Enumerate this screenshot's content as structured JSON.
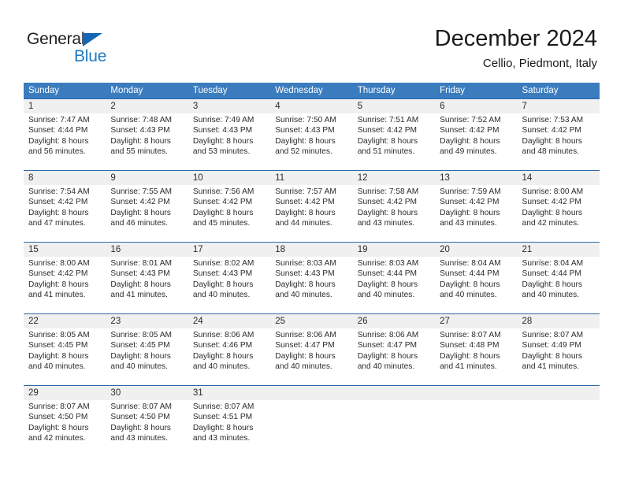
{
  "brand": {
    "word1": "General",
    "word2": "Blue",
    "accent_color": "#1e7bc4",
    "triangle_color": "#1567b3"
  },
  "header": {
    "title": "December 2024",
    "subtitle": "Cellio, Piedmont, Italy"
  },
  "calendar": {
    "header_bg": "#3a7cbe",
    "daynum_band_bg": "#f0f0f0",
    "weekdays": [
      "Sunday",
      "Monday",
      "Tuesday",
      "Wednesday",
      "Thursday",
      "Friday",
      "Saturday"
    ],
    "weeks": [
      [
        {
          "day": "1",
          "sunrise": "Sunrise: 7:47 AM",
          "sunset": "Sunset: 4:44 PM",
          "daylight1": "Daylight: 8 hours",
          "daylight2": "and 56 minutes."
        },
        {
          "day": "2",
          "sunrise": "Sunrise: 7:48 AM",
          "sunset": "Sunset: 4:43 PM",
          "daylight1": "Daylight: 8 hours",
          "daylight2": "and 55 minutes."
        },
        {
          "day": "3",
          "sunrise": "Sunrise: 7:49 AM",
          "sunset": "Sunset: 4:43 PM",
          "daylight1": "Daylight: 8 hours",
          "daylight2": "and 53 minutes."
        },
        {
          "day": "4",
          "sunrise": "Sunrise: 7:50 AM",
          "sunset": "Sunset: 4:43 PM",
          "daylight1": "Daylight: 8 hours",
          "daylight2": "and 52 minutes."
        },
        {
          "day": "5",
          "sunrise": "Sunrise: 7:51 AM",
          "sunset": "Sunset: 4:42 PM",
          "daylight1": "Daylight: 8 hours",
          "daylight2": "and 51 minutes."
        },
        {
          "day": "6",
          "sunrise": "Sunrise: 7:52 AM",
          "sunset": "Sunset: 4:42 PM",
          "daylight1": "Daylight: 8 hours",
          "daylight2": "and 49 minutes."
        },
        {
          "day": "7",
          "sunrise": "Sunrise: 7:53 AM",
          "sunset": "Sunset: 4:42 PM",
          "daylight1": "Daylight: 8 hours",
          "daylight2": "and 48 minutes."
        }
      ],
      [
        {
          "day": "8",
          "sunrise": "Sunrise: 7:54 AM",
          "sunset": "Sunset: 4:42 PM",
          "daylight1": "Daylight: 8 hours",
          "daylight2": "and 47 minutes."
        },
        {
          "day": "9",
          "sunrise": "Sunrise: 7:55 AM",
          "sunset": "Sunset: 4:42 PM",
          "daylight1": "Daylight: 8 hours",
          "daylight2": "and 46 minutes."
        },
        {
          "day": "10",
          "sunrise": "Sunrise: 7:56 AM",
          "sunset": "Sunset: 4:42 PM",
          "daylight1": "Daylight: 8 hours",
          "daylight2": "and 45 minutes."
        },
        {
          "day": "11",
          "sunrise": "Sunrise: 7:57 AM",
          "sunset": "Sunset: 4:42 PM",
          "daylight1": "Daylight: 8 hours",
          "daylight2": "and 44 minutes."
        },
        {
          "day": "12",
          "sunrise": "Sunrise: 7:58 AM",
          "sunset": "Sunset: 4:42 PM",
          "daylight1": "Daylight: 8 hours",
          "daylight2": "and 43 minutes."
        },
        {
          "day": "13",
          "sunrise": "Sunrise: 7:59 AM",
          "sunset": "Sunset: 4:42 PM",
          "daylight1": "Daylight: 8 hours",
          "daylight2": "and 43 minutes."
        },
        {
          "day": "14",
          "sunrise": "Sunrise: 8:00 AM",
          "sunset": "Sunset: 4:42 PM",
          "daylight1": "Daylight: 8 hours",
          "daylight2": "and 42 minutes."
        }
      ],
      [
        {
          "day": "15",
          "sunrise": "Sunrise: 8:00 AM",
          "sunset": "Sunset: 4:42 PM",
          "daylight1": "Daylight: 8 hours",
          "daylight2": "and 41 minutes."
        },
        {
          "day": "16",
          "sunrise": "Sunrise: 8:01 AM",
          "sunset": "Sunset: 4:43 PM",
          "daylight1": "Daylight: 8 hours",
          "daylight2": "and 41 minutes."
        },
        {
          "day": "17",
          "sunrise": "Sunrise: 8:02 AM",
          "sunset": "Sunset: 4:43 PM",
          "daylight1": "Daylight: 8 hours",
          "daylight2": "and 40 minutes."
        },
        {
          "day": "18",
          "sunrise": "Sunrise: 8:03 AM",
          "sunset": "Sunset: 4:43 PM",
          "daylight1": "Daylight: 8 hours",
          "daylight2": "and 40 minutes."
        },
        {
          "day": "19",
          "sunrise": "Sunrise: 8:03 AM",
          "sunset": "Sunset: 4:44 PM",
          "daylight1": "Daylight: 8 hours",
          "daylight2": "and 40 minutes."
        },
        {
          "day": "20",
          "sunrise": "Sunrise: 8:04 AM",
          "sunset": "Sunset: 4:44 PM",
          "daylight1": "Daylight: 8 hours",
          "daylight2": "and 40 minutes."
        },
        {
          "day": "21",
          "sunrise": "Sunrise: 8:04 AM",
          "sunset": "Sunset: 4:44 PM",
          "daylight1": "Daylight: 8 hours",
          "daylight2": "and 40 minutes."
        }
      ],
      [
        {
          "day": "22",
          "sunrise": "Sunrise: 8:05 AM",
          "sunset": "Sunset: 4:45 PM",
          "daylight1": "Daylight: 8 hours",
          "daylight2": "and 40 minutes."
        },
        {
          "day": "23",
          "sunrise": "Sunrise: 8:05 AM",
          "sunset": "Sunset: 4:45 PM",
          "daylight1": "Daylight: 8 hours",
          "daylight2": "and 40 minutes."
        },
        {
          "day": "24",
          "sunrise": "Sunrise: 8:06 AM",
          "sunset": "Sunset: 4:46 PM",
          "daylight1": "Daylight: 8 hours",
          "daylight2": "and 40 minutes."
        },
        {
          "day": "25",
          "sunrise": "Sunrise: 8:06 AM",
          "sunset": "Sunset: 4:47 PM",
          "daylight1": "Daylight: 8 hours",
          "daylight2": "and 40 minutes."
        },
        {
          "day": "26",
          "sunrise": "Sunrise: 8:06 AM",
          "sunset": "Sunset: 4:47 PM",
          "daylight1": "Daylight: 8 hours",
          "daylight2": "and 40 minutes."
        },
        {
          "day": "27",
          "sunrise": "Sunrise: 8:07 AM",
          "sunset": "Sunset: 4:48 PM",
          "daylight1": "Daylight: 8 hours",
          "daylight2": "and 41 minutes."
        },
        {
          "day": "28",
          "sunrise": "Sunrise: 8:07 AM",
          "sunset": "Sunset: 4:49 PM",
          "daylight1": "Daylight: 8 hours",
          "daylight2": "and 41 minutes."
        }
      ],
      [
        {
          "day": "29",
          "sunrise": "Sunrise: 8:07 AM",
          "sunset": "Sunset: 4:50 PM",
          "daylight1": "Daylight: 8 hours",
          "daylight2": "and 42 minutes."
        },
        {
          "day": "30",
          "sunrise": "Sunrise: 8:07 AM",
          "sunset": "Sunset: 4:50 PM",
          "daylight1": "Daylight: 8 hours",
          "daylight2": "and 43 minutes."
        },
        {
          "day": "31",
          "sunrise": "Sunrise: 8:07 AM",
          "sunset": "Sunset: 4:51 PM",
          "daylight1": "Daylight: 8 hours",
          "daylight2": "and 43 minutes."
        },
        {
          "day": "",
          "sunrise": "",
          "sunset": "",
          "daylight1": "",
          "daylight2": ""
        },
        {
          "day": "",
          "sunrise": "",
          "sunset": "",
          "daylight1": "",
          "daylight2": ""
        },
        {
          "day": "",
          "sunrise": "",
          "sunset": "",
          "daylight1": "",
          "daylight2": ""
        },
        {
          "day": "",
          "sunrise": "",
          "sunset": "",
          "daylight1": "",
          "daylight2": ""
        }
      ]
    ]
  }
}
